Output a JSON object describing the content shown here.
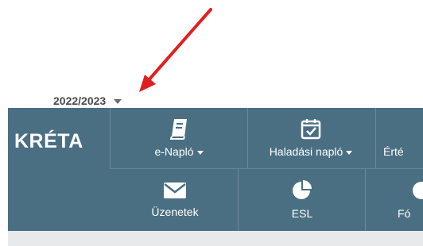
{
  "year_selector": {
    "value": "2022/2023"
  },
  "brand": {
    "logo_text": "KRÉTA"
  },
  "nav": {
    "row1": [
      {
        "label": "e-Napló",
        "icon": "book-icon",
        "has_dropdown": true
      },
      {
        "label": "Haladási napló",
        "icon": "calendar-check-icon",
        "has_dropdown": true
      },
      {
        "label": "Érté",
        "icon": "",
        "has_dropdown": false
      }
    ],
    "row2": [
      {
        "label": "Üzenetek",
        "icon": "envelope-icon"
      },
      {
        "label": "ESL",
        "icon": "pie-chart-icon"
      },
      {
        "label": "Fó",
        "icon": ""
      }
    ]
  },
  "colors": {
    "navbar": "#4b6f82",
    "annotation_arrow": "#e02020",
    "content_background": "#e8e9eb"
  }
}
